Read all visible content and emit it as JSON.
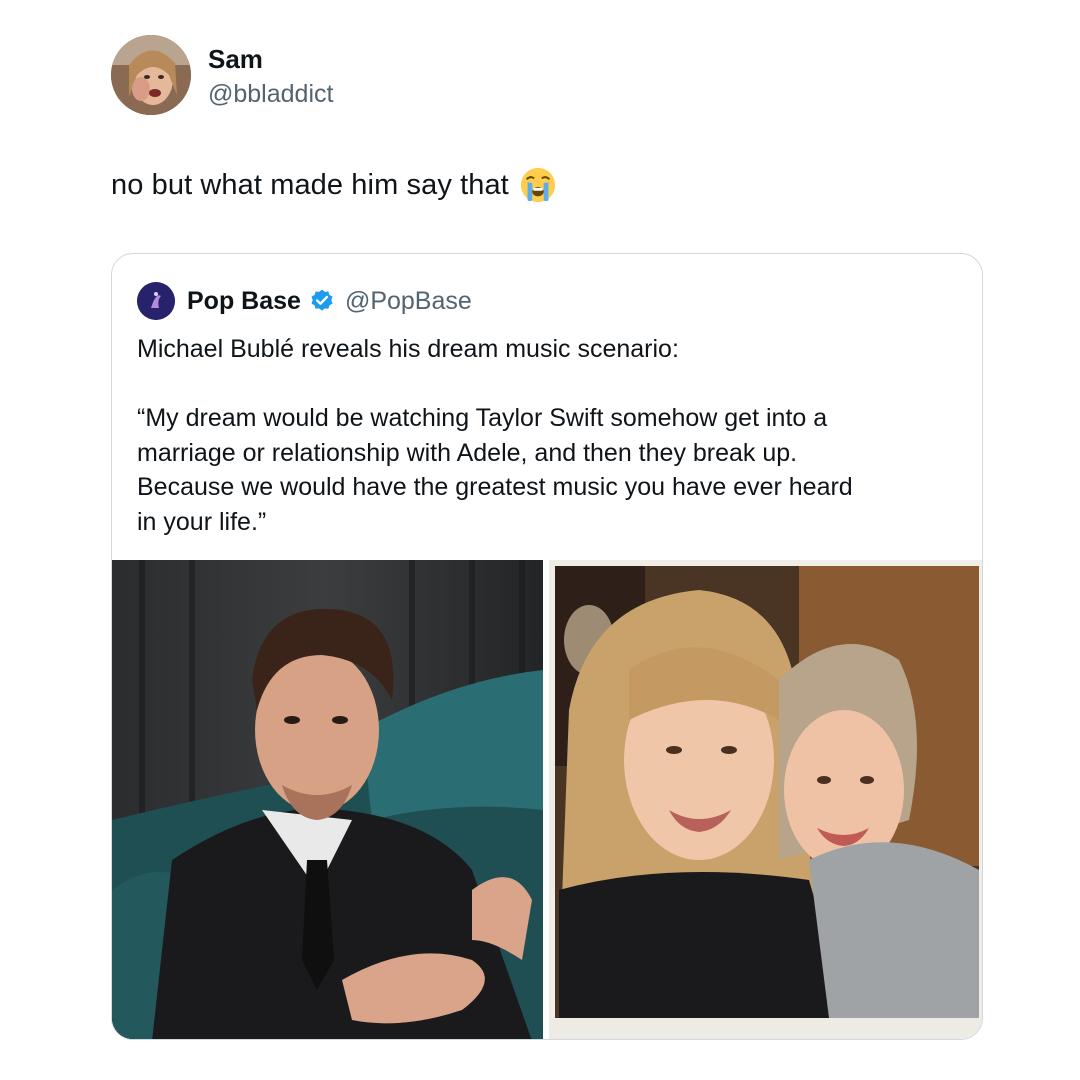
{
  "author": {
    "name": "Sam",
    "handle": "@bbladdict"
  },
  "tweet": {
    "text": "no but what made him say that",
    "emoji": "loudly-crying-face"
  },
  "quoted_tweet": {
    "name": "Pop Base",
    "verified": true,
    "handle": "@PopBase",
    "line1": "Michael Bublé reveals his dream music scenario:",
    "quote_lines": [
      "“My dream would be watching Taylor Swift somehow get into a",
      "marriage or relationship with Adele, and then they break up.",
      "Because we would have the greatest music you have ever heard",
      "in your life.”"
    ],
    "media": [
      {
        "icon": "photo-man-in-suit"
      },
      {
        "icon": "photo-two-women-selfie"
      }
    ]
  },
  "colors": {
    "text_primary": "#0f1419",
    "text_secondary": "#536471",
    "border": "#cfd9de",
    "verified_blue": "#1d9bf0"
  }
}
